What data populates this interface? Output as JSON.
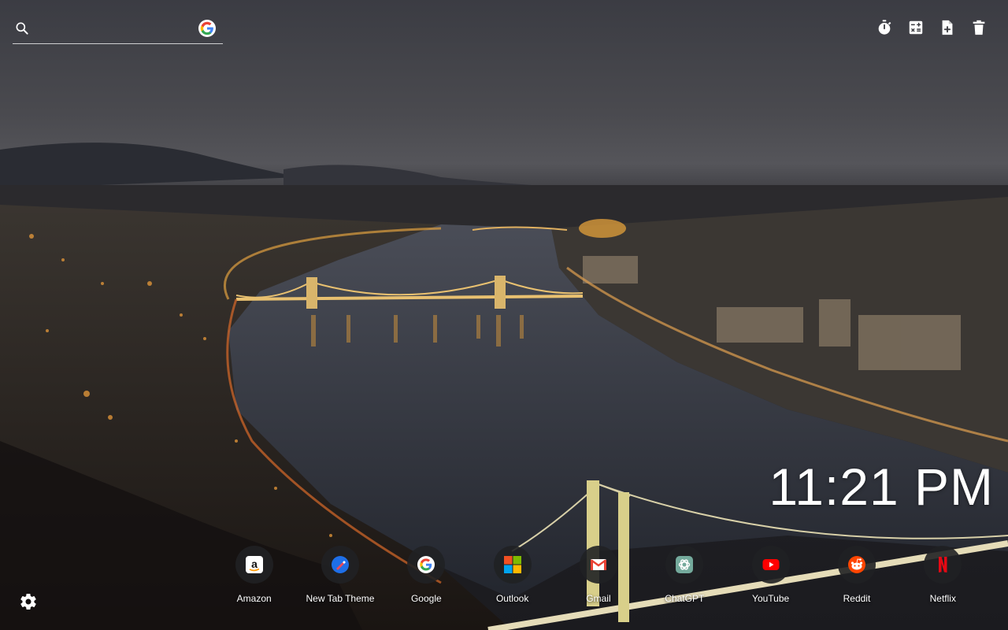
{
  "search": {
    "placeholder": "",
    "value": "",
    "icon": "search-icon",
    "engine_icon": "google-g-icon"
  },
  "toolbar": {
    "items": [
      {
        "icon": "stopwatch-icon"
      },
      {
        "icon": "calculator-icon"
      },
      {
        "icon": "add-note-icon"
      },
      {
        "icon": "trash-icon"
      }
    ]
  },
  "clock": {
    "time": "11:21 PM"
  },
  "shortcuts": [
    {
      "label": "Amazon",
      "icon": "amazon-icon"
    },
    {
      "label": "New Tab Theme",
      "icon": "new-tab-theme-icon"
    },
    {
      "label": "Google",
      "icon": "google-icon"
    },
    {
      "label": "Outlook",
      "icon": "microsoft-icon"
    },
    {
      "label": "Gmail",
      "icon": "gmail-icon"
    },
    {
      "label": "ChatGPT",
      "icon": "chatgpt-icon"
    },
    {
      "label": "YouTube",
      "icon": "youtube-icon"
    },
    {
      "label": "Reddit",
      "icon": "reddit-icon"
    },
    {
      "label": "Netflix",
      "icon": "netflix-icon"
    }
  ],
  "settings": {
    "icon": "gear-icon"
  },
  "colors": {
    "google_blue": "#4285F4",
    "google_red": "#EA4335",
    "google_yellow": "#FBBC05",
    "google_green": "#34A853",
    "youtube_red": "#FF0000",
    "reddit_orange": "#FF4500",
    "netflix_red": "#E50914"
  }
}
